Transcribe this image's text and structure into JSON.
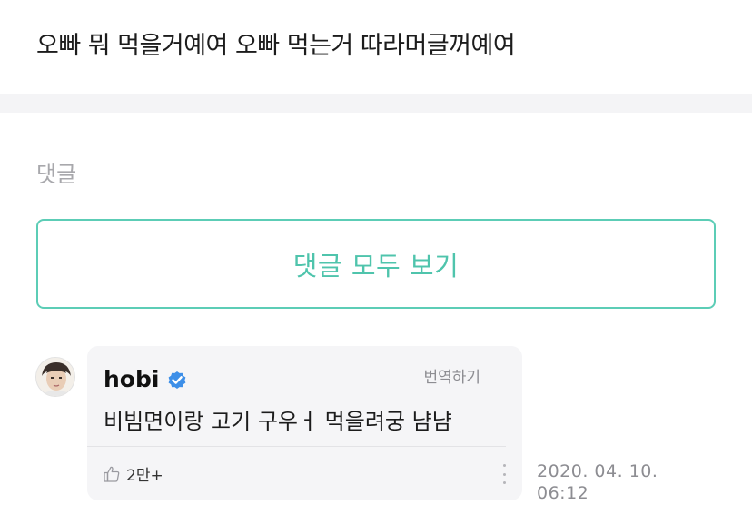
{
  "post": {
    "text": "오빠 뭐 먹을거예여 오빠 먹는거 따라머글꺼예여"
  },
  "comments": {
    "label": "댓글",
    "view_all_label": "댓글 모두 보기",
    "items": [
      {
        "author": "hobi",
        "verified": true,
        "translate_label": "번역하기",
        "text": "비빔면이랑 고기 구우ㅓ 먹을려궁 냠냠",
        "like_count": "2만+",
        "date": "2020. 04. 10.",
        "time": "06:12"
      }
    ]
  },
  "icons": {
    "verified": "verified-check-icon",
    "like": "thumbs-up-icon",
    "more": "more-vertical-icon",
    "avatar": "avatar-image"
  },
  "colors": {
    "accent": "#4fc4ac",
    "verified_blue": "#3d8fe8"
  }
}
